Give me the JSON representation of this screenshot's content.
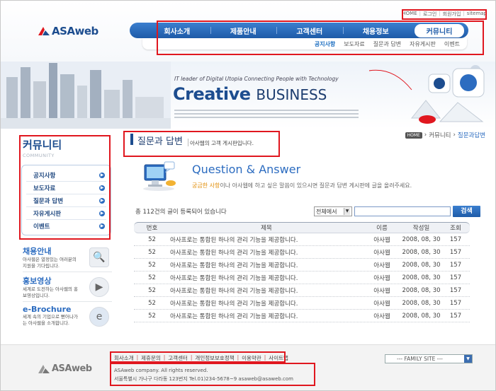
{
  "header": {
    "logo_text": "ASAweb",
    "top_menu": [
      "HOME",
      "로그인",
      "회원가입",
      "sitemap"
    ],
    "gnb": [
      "회사소개",
      "제품안내",
      "고객센터",
      "채용정보",
      "커뮤니티"
    ],
    "gnb_active": "커뮤니티",
    "subnav": [
      "공지사항",
      "보도자료",
      "질문과 답변",
      "자유게시판",
      "이벤트"
    ],
    "subnav_selected": "공지사항"
  },
  "banner": {
    "tagline": "IT leader of Digital Utopia Connecting People with Technology",
    "title_bold": "Creative",
    "title_light": "BUSINESS"
  },
  "sidebar": {
    "title": "커뮤니티",
    "subtitle": "COMMUNITY",
    "items": [
      "공지사항",
      "보도자료",
      "질문과 답변",
      "자유게시판",
      "이벤트"
    ],
    "promos": [
      {
        "title": "채용안내",
        "desc": "아사웹은 열정있는 여러분의 지원을 기다립니다."
      },
      {
        "title": "홍보영상",
        "desc": "세계로 도전하는 아사웹의 홍보영상입니다."
      },
      {
        "title": "e-Brochure",
        "desc": "세계 속의 기업으로 뻗어나가는 아사웹을 소개합니다."
      }
    ]
  },
  "content": {
    "title": "질문과 답변",
    "description": "아사웹의 고객 게시판입니다.",
    "breadcrumb": {
      "home": "HOME",
      "section": "커뮤니티",
      "current": "질문과답변"
    },
    "qa_title": "Question & Answer",
    "qa_desc_highlight": "궁금한 사항",
    "qa_desc_rest": "이나 아사웹에 하고 싶은 말씀이 있으시면 질문과 답변 게시판에 글을 올려주세요.",
    "total_text": "총 112건의 글이 등록되어 있습니다",
    "search_select": "전체에서",
    "search_button": "검색",
    "columns": [
      "번호",
      "제목",
      "이름",
      "작성일",
      "조회"
    ],
    "rows": [
      {
        "no": "52",
        "subject": "아사프로는 통합된 하나의 관리 기능을 제공합니다.",
        "name": "아사웹",
        "date": "2008, 08, 30",
        "hits": "157"
      },
      {
        "no": "52",
        "subject": "아사프로는 통합된 하나의 관리 기능을 제공합니다.",
        "name": "아사웹",
        "date": "2008, 08, 30",
        "hits": "157"
      },
      {
        "no": "52",
        "subject": "아사프로는 통합된 하나의 관리 기능을 제공합니다.",
        "name": "아사웹",
        "date": "2008, 08, 30",
        "hits": "157"
      },
      {
        "no": "52",
        "subject": "아사프로는 통합된 하나의 관리 기능을 제공합니다.",
        "name": "아사웹",
        "date": "2008, 08, 30",
        "hits": "157"
      },
      {
        "no": "52",
        "subject": "아사프로는 통합된 하나의 관리 기능을 제공합니다.",
        "name": "아사웹",
        "date": "2008, 08, 30",
        "hits": "157"
      },
      {
        "no": "52",
        "subject": "아사프로는 통합된 하나의 관리 기능을 제공합니다.",
        "name": "아사웹",
        "date": "2008, 08, 30",
        "hits": "157"
      },
      {
        "no": "52",
        "subject": "아사프로는 통합된 하나의 관리 기능을 제공합니다.",
        "name": "아사웹",
        "date": "2008, 08, 30",
        "hits": "157"
      }
    ]
  },
  "footer": {
    "logo_text": "ASAweb",
    "links": [
      "회사소개",
      "제휴문의",
      "고객센터",
      "개인정보보호정책",
      "이용약관",
      "사이트맵"
    ],
    "copyright": "ASAweb company. All rights reserved.",
    "address": "서울특별시 가나구 다라동 123번지 Tel.01)234-5678~9 asaweb@asaweb.com",
    "family_site": "--- FAMILY SITE ---"
  },
  "colors": {
    "brand_blue": "#1d4d8f",
    "accent_blue": "#2c6cc0",
    "highlight_box": "#e0171f",
    "highlight_text": "#e08a00"
  }
}
